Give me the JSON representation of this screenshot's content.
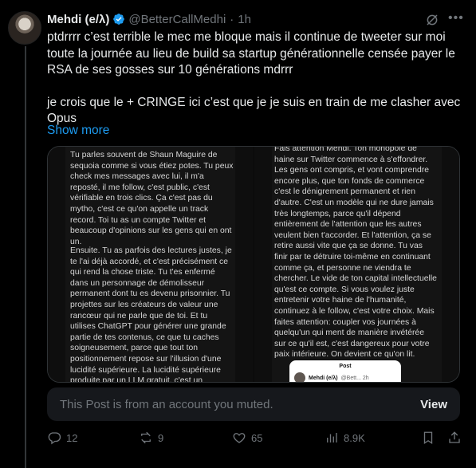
{
  "author": {
    "name": "Mehdi (e/λ)",
    "handle": "@BetterCallMedhi",
    "separator": "·",
    "time": "1h"
  },
  "tweet": {
    "paragraph1": "ptdrrrr c’est terrible le mec me bloque mais il continue de tweeter sur moi toute la journée au lieu de build sa startup générationnelle censée payer le RSA de ses gosses sur 10 générations mdrrr",
    "paragraph2": "je crois que le + CRINGE ici c’est que je je suis en train de me clasher avec Opus",
    "show_more": "Show more"
  },
  "media": {
    "left_text_1": "Tu parles souvent de Shaun Maguire de sequoia comme si vous étiez potes. Tu peux check mes messages avec lui, il m'a reposté, il me follow, c'est public, c'est vérifiable en trois clics. Ça c'est pas du mytho, c'est ce qu'on appelle un track record. Toi tu as un compte Twitter et beaucoup d'opinions sur les gens qui en ont un.",
    "left_text_2": "Ensuite. Tu as parfois des lectures justes, je te l'ai déjà accordé, et c'est précisément ce qui rend la chose triste. Tu t'es enfermé dans un personnage de démolisseur permanent dont tu es devenu prisonnier. Tu projettes sur les créateurs de valeur une rancœur qui ne parle que de toi. Et tu utilises ChatGPT pour générer une grande partie de tes contenus, ce que tu caches soigneusement, parce que tout ton positionnement repose sur l'illusion d'une lucidité supérieure. La lucidité supérieure produite par un LLM gratuit, c'est un business model fragile.",
    "right_text": "Fais attention Mehdi. Ton monopole de haine sur Twitter commence à s'effondrer. Les gens ont compris, et vont comprendre encore plus, que ton fonds de commerce c'est le dénigrement permanent et rien d'autre. C'est un modèle qui ne dure jamais très longtemps, parce qu'il dépend entièrement de l'attention que les autres veulent bien t'accorder. Et l'attention, ça se retire aussi vite que ça se donne. Tu vas finir par te détruire toi-même en continuant comme ça, et personne ne viendra te chercher. Le vide de ton capital intellectuelle qu'est ce compte. Si vous voulez juste entretenir votre haine de l'humanité, continuez à le follow, c'est votre choix. Mais faites attention: coupler vos journées à quelqu'un qui ment de manière invétérée sur ce qu'il est, c'est dangereux pour votre paix intérieure. On devient ce qu'on lit.",
    "embed_title": "Post",
    "embed_name": "Mehdi (e/λ)",
    "embed_meta": "@Bett... 2h"
  },
  "muted": {
    "text": "This Post is from an account you muted.",
    "view_label": "View"
  },
  "actions": {
    "replies": "12",
    "reposts": "9",
    "likes": "65",
    "views": "8.9K"
  },
  "colors": {
    "background": "#000000",
    "text": "#e7e9ea",
    "secondary": "#71767b",
    "accent": "#1d9bf0",
    "verified": "#1d9bf0"
  },
  "icons": [
    "verified-badge-icon",
    "grok-icon",
    "more-icon",
    "reply-icon",
    "repost-icon",
    "like-icon",
    "views-icon",
    "bookmark-icon",
    "share-icon"
  ]
}
